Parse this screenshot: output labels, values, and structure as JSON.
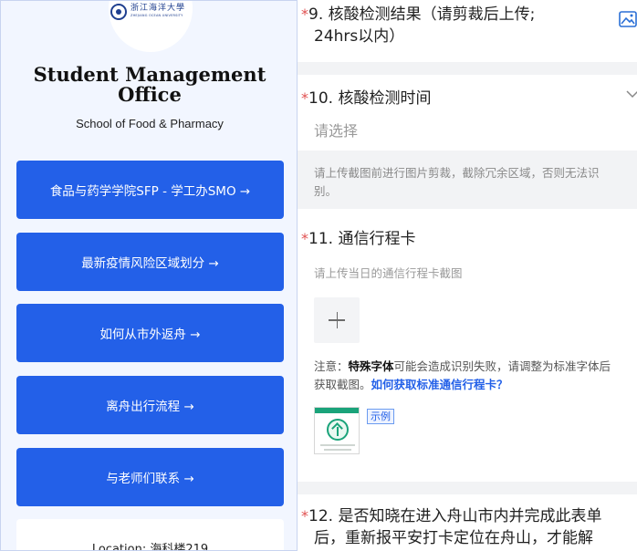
{
  "left_panel": {
    "logo": {
      "cn": "浙江海洋大學",
      "en": "ZHEJIANG OCEAN UNIVERSITY"
    },
    "title_line1": "Student Management",
    "title_line2": "Office",
    "school": "School of Food & Pharmacy",
    "nav_buttons": [
      "食品与药学学院SFP - 学工办SMO →",
      "最新疫情风险区域划分 →",
      "如何从市外返舟 →",
      "离舟出行流程 →",
      "与老师们联系 →"
    ],
    "location": "Location: 海科楼219",
    "colors": {
      "panel_bg": "#f2f6ff",
      "button_blue": "#2360e8"
    }
  },
  "form": {
    "q9": {
      "required": "*",
      "line1": "9. 核酸检测结果（请剪裁后上传;",
      "line2": "24hrs以内）",
      "icon": "image-icon"
    },
    "q10": {
      "required": "*",
      "title": "10. 核酸检测时间",
      "placeholder": "请选择",
      "icon": "chevron-down-icon"
    },
    "crop_hint": {
      "line1": "请上传截图前进行图片剪裁，截除冗余区域，否则无法识",
      "line2": "别。"
    },
    "q11": {
      "required": "*",
      "title": "11. 通信行程卡",
      "desc": "请上传当日的通信行程卡截图",
      "upload_icon": "plus-icon",
      "note_prefix": "注意：",
      "note_bold": "特殊字体",
      "note_mid": "可能会造成识别失败，请调整为标准字体后",
      "note_line2_start": "获取截图。",
      "note_link": "如何获取标准通信行程卡？",
      "sample_tag": "示例"
    },
    "q12": {
      "required": "*",
      "line1": "12. 是否知晓在进入舟山市内并完成此表单",
      "line2": "后，重新报平安打卡定位在舟山，才能解"
    },
    "colors": {
      "required_red": "#e05050",
      "link_blue": "#2360e8",
      "gap_gray": "#f2f3f5"
    }
  }
}
